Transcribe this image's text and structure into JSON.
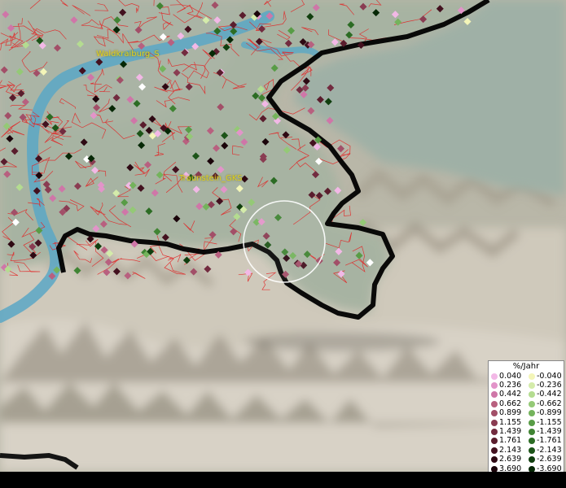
{
  "map": {
    "labels": [
      {
        "text": "Waldkraiburg_S"
      },
      {
        "text": "Traunstein_GKS"
      }
    ]
  },
  "legend": {
    "title": "%/Jahr",
    "positive": [
      {
        "value": "0.040",
        "color": "#f2b8e6"
      },
      {
        "value": "0.236",
        "color": "#e294c9"
      },
      {
        "value": "0.442",
        "color": "#cf76a8"
      },
      {
        "value": "0.662",
        "color": "#b8607f"
      },
      {
        "value": "0.899",
        "color": "#a24f68"
      },
      {
        "value": "1.155",
        "color": "#8a3c52"
      },
      {
        "value": "1.439",
        "color": "#722b3f"
      },
      {
        "value": "1.761",
        "color": "#5a1d2d"
      },
      {
        "value": "2.143",
        "color": "#43111f"
      },
      {
        "value": "2.639",
        "color": "#2e0913"
      },
      {
        "value": "3.690",
        "color": "#1a040a"
      }
    ],
    "negative": [
      {
        "value": "-0.040",
        "color": "#f3f5b8"
      },
      {
        "value": "-0.236",
        "color": "#d4ebaa"
      },
      {
        "value": "-0.442",
        "color": "#b4dc90"
      },
      {
        "value": "-0.662",
        "color": "#94c976"
      },
      {
        "value": "-0.899",
        "color": "#74b35c"
      },
      {
        "value": "-1.155",
        "color": "#589c46"
      },
      {
        "value": "-1.439",
        "color": "#408433"
      },
      {
        "value": "-1.761",
        "color": "#2c6c24"
      },
      {
        "value": "-2.143",
        "color": "#1c5418"
      },
      {
        "value": "-2.639",
        "color": "#103e0e"
      },
      {
        "value": "-3.690",
        "color": "#062806"
      }
    ]
  }
}
